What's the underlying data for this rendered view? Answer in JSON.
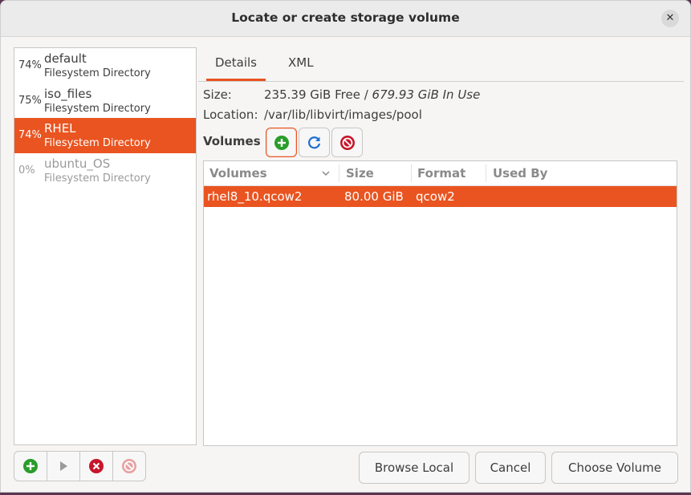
{
  "window": {
    "title": "Locate or create storage volume",
    "close_glyph": "✕"
  },
  "pools": [
    {
      "pct": "74%",
      "name": "default",
      "type": "Filesystem Directory",
      "state": "normal"
    },
    {
      "pct": "75%",
      "name": "iso_files",
      "type": "Filesystem Directory",
      "state": "normal"
    },
    {
      "pct": "74%",
      "name": "RHEL",
      "type": "Filesystem Directory",
      "state": "selected"
    },
    {
      "pct": "0%",
      "name": "ubuntu_OS",
      "type": "Filesystem Directory",
      "state": "inactive"
    }
  ],
  "tabs": {
    "details": "Details",
    "xml": "XML"
  },
  "details": {
    "size_label": "Size:",
    "size_free": "235.39 GiB Free / ",
    "size_in_use": "679.93 GiB In Use",
    "location_label": "Location:",
    "location_value": "/var/lib/libvirt/images/pool",
    "volumes_label": "Volumes"
  },
  "volumes_table": {
    "columns": {
      "name": "Volumes",
      "size": "Size",
      "format": "Format",
      "used_by": "Used By"
    },
    "rows": [
      {
        "name": "rhel8_10.qcow2",
        "size": "80.00 GiB",
        "format": "qcow2",
        "used_by": ""
      }
    ]
  },
  "buttons": {
    "browse_local": "Browse Local",
    "cancel": "Cancel",
    "choose_volume": "Choose Volume"
  },
  "colors": {
    "accent": "#e95420",
    "add": "#2a9d2a",
    "refresh": "#1f6fd0",
    "delete": "#c7162b"
  }
}
